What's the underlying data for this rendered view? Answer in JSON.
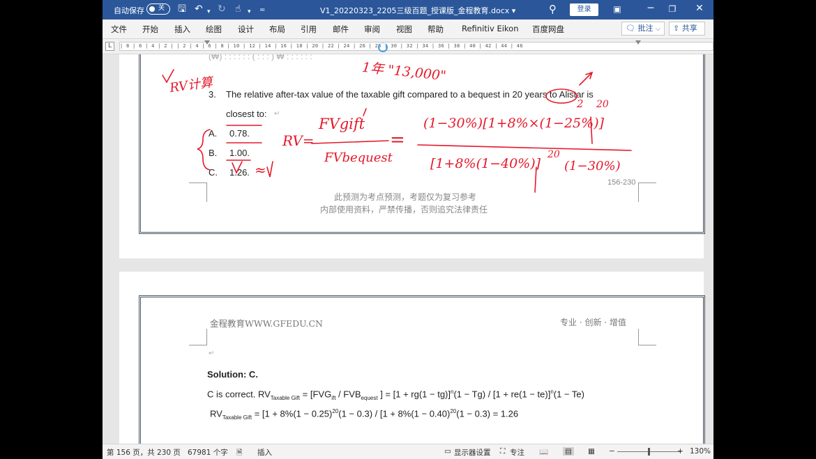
{
  "titlebar": {
    "autosave_label": "自动保存",
    "autosave_state": "关",
    "doc_title": "V1_20220323_2205三级百题_授课版_金程教育.docx ▾",
    "login_label": "登录",
    "icons": [
      "save-icon",
      "undo-icon",
      "redo-icon",
      "touch-icon",
      "customize-icon",
      "search-icon",
      "ribbon-display-icon",
      "minimize-icon",
      "restore-icon",
      "close-icon"
    ]
  },
  "menubar": {
    "tabs": [
      "文件",
      "开始",
      "插入",
      "绘图",
      "设计",
      "布局",
      "引用",
      "邮件",
      "审阅",
      "视图",
      "帮助",
      "Refinitiv Eikon",
      "百度网盘"
    ],
    "comment_label": "批注",
    "share_label": "共享"
  },
  "ruler": {
    "corner": "L",
    "ticks": "| 8 | 6 | 4 | 2 |   | 2 | 4 | 6 | 8 | 10 | 12 | 14 | 16 | 18 | 20 | 22 | 24 | 26 | 28 | 30 | 32 | 34 | 36 | 38 | 40 | 42 | 44 | 46"
  },
  "page1": {
    "question_number": "3.",
    "question_line1": "The relative after-tax value of the taxable gift compared to a bequest in 20 years to Alistar is",
    "question_line2": "closest to:",
    "options": [
      {
        "letter": "A.",
        "value": "0.78."
      },
      {
        "letter": "B.",
        "value": "1.00."
      },
      {
        "letter": "C.",
        "value": "1.26."
      }
    ],
    "page_number": "156-230",
    "footer_line1": "此预测为考点预测，考题仅为复习参考",
    "footer_line2": "内部使用资料，严禁传播，否则追究法律责任"
  },
  "page2": {
    "header_left": "金程教育WWW.GFEDU.CN",
    "header_right": "专业 · 创新 · 增值",
    "solution_label": "Solution: C.",
    "line1": {
      "a": "C is correct. RV",
      "a_sub": "Taxable Gift",
      "b": " = [FVG",
      "b_sub": "ift",
      "c": " / FVB",
      "c_sub": "equest",
      "d": " ] = [1 + rg(1 − tg)]",
      "d_sup": "n",
      "e": "(1 − Tg) / [1 + re(1 − te)]",
      "e_sup": "n",
      "f": "(1 − Te)"
    },
    "line2": {
      "a": "RV",
      "a_sub": "Taxable Gift",
      "b": " = [1 + 8%(1 − 0.25)",
      "b_sup": "20",
      "c": "(1 − 0.3) / [1 + 8%(1 − 0.40)",
      "c_sup": "20",
      "d": "(1 − 0.3) = 1.26"
    }
  },
  "handwriting": {
    "rv_note": "RV计算",
    "top_note": "1年 \"13,000\"",
    "rv_label": "RV=",
    "numerator": "FVgift",
    "denominator": "FVbequest",
    "equals": "=",
    "rhs_numerator": "(1−30%)[1+8%×(1−25%)]",
    "rhs_numerator_exp": "20",
    "rhs_denominator": "[1+8%(1−40%)]",
    "rhs_denominator_exp": "20",
    "rhs_denominator_tail": "(1−30%)",
    "approx": "≈",
    "marker_2": "2"
  },
  "statusbar": {
    "page_info": "第 156 页，共 230 页",
    "word_count": "67981 个字",
    "insert_mode": "插入",
    "display_settings": "显示器设置",
    "focus": "专注",
    "zoom_minus": "−",
    "zoom_plus": "+",
    "zoom_level": "130%"
  },
  "colors": {
    "titlebar": "#2b579a",
    "ink": "#e5182a",
    "frame": "#4a5363"
  }
}
